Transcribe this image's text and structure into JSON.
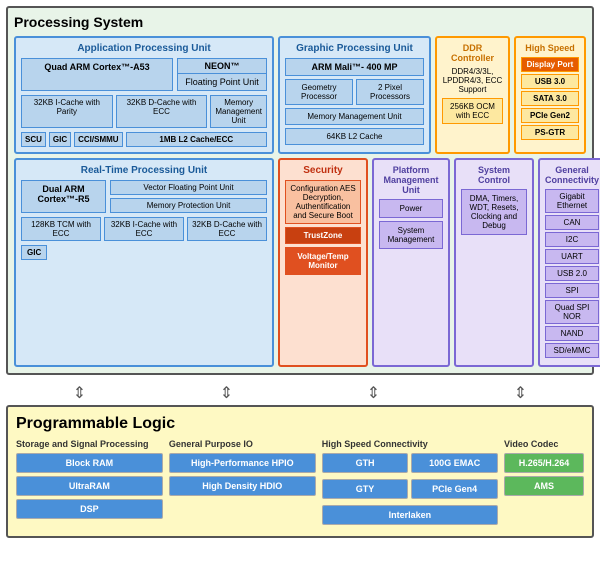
{
  "processing_system": {
    "title": "Processing System",
    "apu": {
      "title": "Application Processing Unit",
      "cortex": "Quad ARM Cortex™-A53",
      "neon": "NEON™",
      "fpu": "Floating Point Unit",
      "icache": "32KB I-Cache with Parity",
      "dcache": "32KB D-Cache with ECC",
      "mmu": "Memory Management Unit",
      "scu": "SCU",
      "gic": "GIC",
      "ccismmu": "CCI/SMMU",
      "l2cache": "1MB L2 Cache/ECC"
    },
    "gpu": {
      "title": "Graphic Processing Unit",
      "arm": "ARM Mali™- 400 MP",
      "geometry": "Geometry Processor",
      "pixel": "2 Pixel Processors",
      "mmu": "Memory Management Unit",
      "l2cache": "64KB L2 Cache"
    },
    "ddr": {
      "title": "DDR Controller",
      "content": "DDR4/3/3L, LPDDR4/3, ECC Support",
      "ocm": "256KB OCM with ECC"
    },
    "highspeed": {
      "title": "High Speed",
      "items": [
        "Display Port",
        "USB 3.0",
        "SATA 3.0",
        "PCIe Gen2",
        "PS-GTR"
      ],
      "highlight": "Display Port"
    },
    "rpu": {
      "title": "Real-Time Processing Unit",
      "cortex": "Dual ARM Cortex™-R5",
      "vfpu": "Vector Floating Point Unit",
      "mpu": "Memory Protection Unit",
      "tcm": "128KB TCM with ECC",
      "icache": "32KB I-Cache with ECC",
      "dcache": "32KB D-Cache with ECC",
      "gic": "GIC"
    },
    "security": {
      "title": "Security",
      "aes": "Configuration AES Decryption, Authentification and Secure Boot",
      "tz": "TrustZone",
      "vtm": "Voltage/Temp Monitor"
    },
    "pmu": {
      "title": "Platform Management Unit",
      "power": "Power",
      "system": "System Management"
    },
    "system_control": {
      "title": "System Control",
      "content": "DMA, Timers, WDT, Resets, Clocking and Debug"
    },
    "general_connectivity": {
      "title": "General Connectivity",
      "items": [
        "Gigabit Ethernet",
        "CAN",
        "I2C",
        "UART",
        "USB 2.0",
        "SPI",
        "Quad SPI NOR",
        "NAND",
        "SD/eMMC"
      ]
    }
  },
  "programmable_logic": {
    "title": "Programmable Logic",
    "storage": {
      "title": "Storage and Signal Processing",
      "items": [
        "Block RAM",
        "UltraRAM",
        "DSP"
      ]
    },
    "gp_io": {
      "title": "General Purpose IO",
      "items": [
        "High-Performance HPIO",
        "High Density HDIO"
      ]
    },
    "hs_connectivity": {
      "title": "High Speed Connectivity",
      "items": [
        "GTH",
        "100G EMAC",
        "GTY",
        "PCIe Gen4",
        "Interlaken"
      ]
    },
    "video_codec": {
      "title": "Video Codec",
      "items": [
        "H.265/H.264",
        "AMS"
      ]
    }
  }
}
